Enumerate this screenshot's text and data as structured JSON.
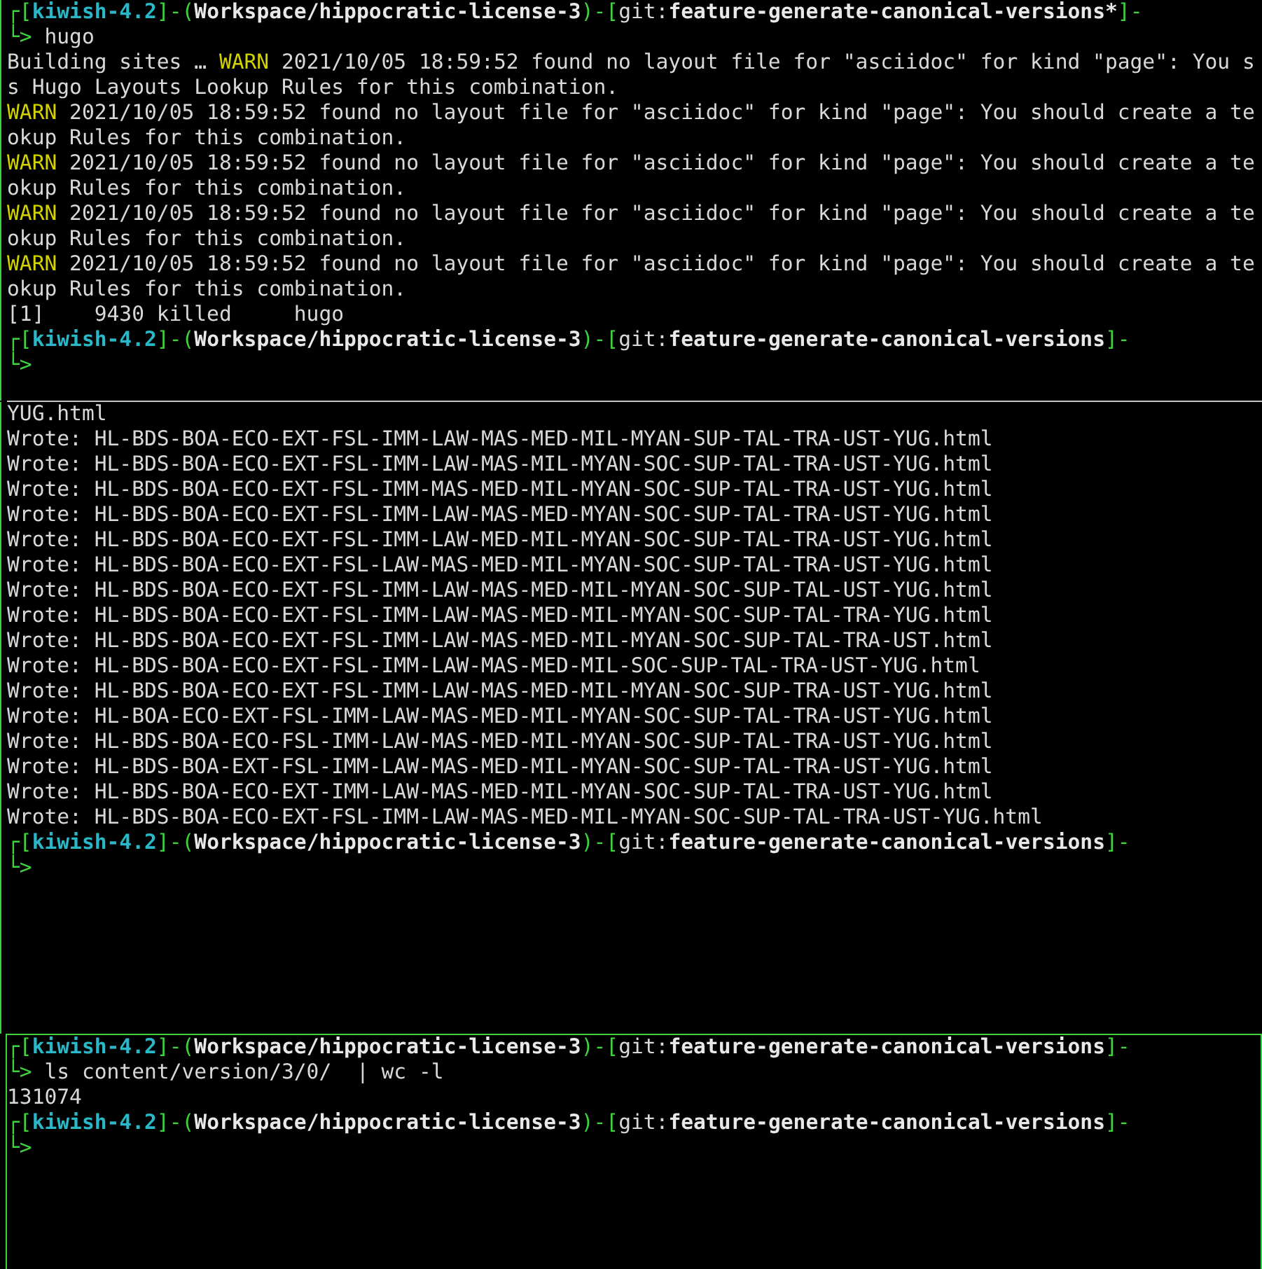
{
  "panes": [
    {
      "active": false,
      "lines": [
        [
          {
            "text": "┌[",
            "kind": "frame"
          },
          {
            "text": "kiwish-4.2",
            "kind": "host"
          },
          {
            "text": "]-(",
            "kind": "frame"
          },
          {
            "text": "Workspace/hippocratic-license-3",
            "kind": "path"
          },
          {
            "text": ")-[",
            "kind": "frame"
          },
          {
            "text": "git:",
            "kind": "text"
          },
          {
            "text": "feature-generate-canonical-versions*",
            "kind": "branch"
          },
          {
            "text": "]-",
            "kind": "frame"
          }
        ],
        [
          {
            "text": "└> ",
            "kind": "frame"
          },
          {
            "text": "hugo",
            "kind": "text"
          }
        ],
        [
          {
            "text": "Building sites … ",
            "kind": "text"
          },
          {
            "text": "WARN",
            "kind": "warn"
          },
          {
            "text": " 2021/10/05 18:59:52 found no layout file for \"asciidoc\" for kind \"page\": You s",
            "kind": "text"
          }
        ],
        [
          {
            "text": "s Hugo Layouts Lookup Rules for this combination.",
            "kind": "text"
          }
        ],
        [
          {
            "text": "WARN",
            "kind": "warn"
          },
          {
            "text": " 2021/10/05 18:59:52 found no layout file for \"asciidoc\" for kind \"page\": You should create a te",
            "kind": "text"
          }
        ],
        [
          {
            "text": "okup Rules for this combination.",
            "kind": "text"
          }
        ],
        [
          {
            "text": "WARN",
            "kind": "warn"
          },
          {
            "text": " 2021/10/05 18:59:52 found no layout file for \"asciidoc\" for kind \"page\": You should create a te",
            "kind": "text"
          }
        ],
        [
          {
            "text": "okup Rules for this combination.",
            "kind": "text"
          }
        ],
        [
          {
            "text": "WARN",
            "kind": "warn"
          },
          {
            "text": " 2021/10/05 18:59:52 found no layout file for \"asciidoc\" for kind \"page\": You should create a te",
            "kind": "text"
          }
        ],
        [
          {
            "text": "okup Rules for this combination.",
            "kind": "text"
          }
        ],
        [
          {
            "text": "WARN",
            "kind": "warn"
          },
          {
            "text": " 2021/10/05 18:59:52 found no layout file for \"asciidoc\" for kind \"page\": You should create a te",
            "kind": "text"
          }
        ],
        [
          {
            "text": "okup Rules for this combination.",
            "kind": "text"
          }
        ],
        [
          {
            "text": "[1]    9430 killed     hugo",
            "kind": "text"
          }
        ],
        [
          {
            "text": "┌[",
            "kind": "frame"
          },
          {
            "text": "kiwish-4.2",
            "kind": "host"
          },
          {
            "text": "]-(",
            "kind": "frame"
          },
          {
            "text": "Workspace/hippocratic-license-3",
            "kind": "path"
          },
          {
            "text": ")-[",
            "kind": "frame"
          },
          {
            "text": "git:",
            "kind": "text"
          },
          {
            "text": "feature-generate-canonical-versions",
            "kind": "branch"
          },
          {
            "text": "]-",
            "kind": "frame"
          }
        ],
        [
          {
            "text": "└>",
            "kind": "frame"
          }
        ]
      ]
    },
    {
      "active": false,
      "lines": [
        [
          {
            "text": "YUG.html",
            "kind": "text"
          }
        ],
        [
          {
            "text": "Wrote: HL-BDS-BOA-ECO-EXT-FSL-IMM-LAW-MAS-MED-MIL-MYAN-SUP-TAL-TRA-UST-YUG.html",
            "kind": "text"
          }
        ],
        [
          {
            "text": "Wrote: HL-BDS-BOA-ECO-EXT-FSL-IMM-LAW-MAS-MIL-MYAN-SOC-SUP-TAL-TRA-UST-YUG.html",
            "kind": "text"
          }
        ],
        [
          {
            "text": "Wrote: HL-BDS-BOA-ECO-EXT-FSL-IMM-MAS-MED-MIL-MYAN-SOC-SUP-TAL-TRA-UST-YUG.html",
            "kind": "text"
          }
        ],
        [
          {
            "text": "Wrote: HL-BDS-BOA-ECO-EXT-FSL-IMM-LAW-MAS-MED-MYAN-SOC-SUP-TAL-TRA-UST-YUG.html",
            "kind": "text"
          }
        ],
        [
          {
            "text": "Wrote: HL-BDS-BOA-ECO-EXT-FSL-IMM-LAW-MED-MIL-MYAN-SOC-SUP-TAL-TRA-UST-YUG.html",
            "kind": "text"
          }
        ],
        [
          {
            "text": "Wrote: HL-BDS-BOA-ECO-EXT-FSL-LAW-MAS-MED-MIL-MYAN-SOC-SUP-TAL-TRA-UST-YUG.html",
            "kind": "text"
          }
        ],
        [
          {
            "text": "Wrote: HL-BDS-BOA-ECO-EXT-FSL-IMM-LAW-MAS-MED-MIL-MYAN-SOC-SUP-TAL-UST-YUG.html",
            "kind": "text"
          }
        ],
        [
          {
            "text": "Wrote: HL-BDS-BOA-ECO-EXT-FSL-IMM-LAW-MAS-MED-MIL-MYAN-SOC-SUP-TAL-TRA-YUG.html",
            "kind": "text"
          }
        ],
        [
          {
            "text": "Wrote: HL-BDS-BOA-ECO-EXT-FSL-IMM-LAW-MAS-MED-MIL-MYAN-SOC-SUP-TAL-TRA-UST.html",
            "kind": "text"
          }
        ],
        [
          {
            "text": "Wrote: HL-BDS-BOA-ECO-EXT-FSL-IMM-LAW-MAS-MED-MIL-SOC-SUP-TAL-TRA-UST-YUG.html",
            "kind": "text"
          }
        ],
        [
          {
            "text": "Wrote: HL-BDS-BOA-ECO-EXT-FSL-IMM-LAW-MAS-MED-MIL-MYAN-SOC-SUP-TRA-UST-YUG.html",
            "kind": "text"
          }
        ],
        [
          {
            "text": "Wrote: HL-BOA-ECO-EXT-FSL-IMM-LAW-MAS-MED-MIL-MYAN-SOC-SUP-TAL-TRA-UST-YUG.html",
            "kind": "text"
          }
        ],
        [
          {
            "text": "Wrote: HL-BDS-BOA-ECO-FSL-IMM-LAW-MAS-MED-MIL-MYAN-SOC-SUP-TAL-TRA-UST-YUG.html",
            "kind": "text"
          }
        ],
        [
          {
            "text": "Wrote: HL-BDS-BOA-EXT-FSL-IMM-LAW-MAS-MED-MIL-MYAN-SOC-SUP-TAL-TRA-UST-YUG.html",
            "kind": "text"
          }
        ],
        [
          {
            "text": "Wrote: HL-BDS-BOA-ECO-EXT-IMM-LAW-MAS-MED-MIL-MYAN-SOC-SUP-TAL-TRA-UST-YUG.html",
            "kind": "text"
          }
        ],
        [
          {
            "text": "Wrote: HL-BDS-BOA-ECO-EXT-FSL-IMM-LAW-MAS-MED-MIL-MYAN-SOC-SUP-TAL-TRA-UST-YUG.html",
            "kind": "text"
          }
        ],
        [
          {
            "text": "┌[",
            "kind": "frame"
          },
          {
            "text": "kiwish-4.2",
            "kind": "host"
          },
          {
            "text": "]-(",
            "kind": "frame"
          },
          {
            "text": "Workspace/hippocratic-license-3",
            "kind": "path"
          },
          {
            "text": ")-[",
            "kind": "frame"
          },
          {
            "text": "git:",
            "kind": "text"
          },
          {
            "text": "feature-generate-canonical-versions",
            "kind": "branch"
          },
          {
            "text": "]-",
            "kind": "frame"
          }
        ],
        [
          {
            "text": "└>",
            "kind": "frame"
          }
        ]
      ]
    },
    {
      "active": true,
      "lines": [
        [
          {
            "text": "┌[",
            "kind": "frame"
          },
          {
            "text": "kiwish-4.2",
            "kind": "host"
          },
          {
            "text": "]-(",
            "kind": "frame"
          },
          {
            "text": "Workspace/hippocratic-license-3",
            "kind": "path"
          },
          {
            "text": ")-[",
            "kind": "frame"
          },
          {
            "text": "git:",
            "kind": "text"
          },
          {
            "text": "feature-generate-canonical-versions",
            "kind": "branch"
          },
          {
            "text": "]-",
            "kind": "frame"
          }
        ],
        [
          {
            "text": "└> ",
            "kind": "frame"
          },
          {
            "text": "ls content/version/3/0/  | wc -l",
            "kind": "text"
          }
        ],
        [
          {
            "text": "131074",
            "kind": "text"
          }
        ],
        [
          {
            "text": "┌[",
            "kind": "frame"
          },
          {
            "text": "kiwish-4.2",
            "kind": "host"
          },
          {
            "text": "]-(",
            "kind": "frame"
          },
          {
            "text": "Workspace/hippocratic-license-3",
            "kind": "path"
          },
          {
            "text": ")-[",
            "kind": "frame"
          },
          {
            "text": "git:",
            "kind": "text"
          },
          {
            "text": "feature-generate-canonical-versions",
            "kind": "branch"
          },
          {
            "text": "]-",
            "kind": "frame"
          }
        ],
        [
          {
            "text": "└>",
            "kind": "frame"
          }
        ]
      ]
    }
  ]
}
